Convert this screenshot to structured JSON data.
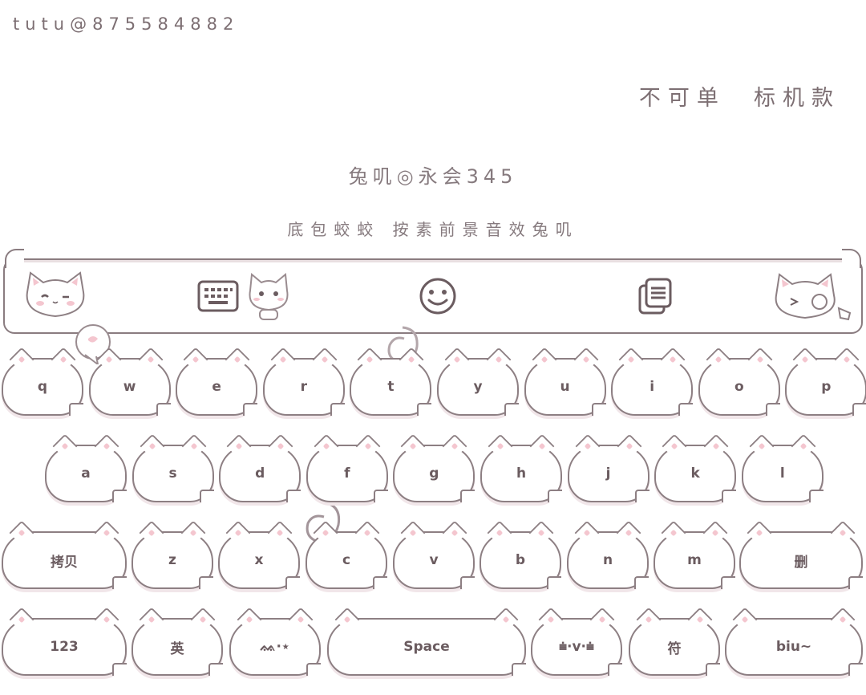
{
  "header": {
    "watermark": "tutu@875584882",
    "style_name": "不可单  标机款",
    "headline": "兔叽◎永会345",
    "subline": "底包蛟蛟  按素前景音效兔叽"
  },
  "toolbar": {
    "items": [
      {
        "name": "keyboard-icon"
      },
      {
        "name": "emoji-icon"
      },
      {
        "name": "clipboard-icon"
      }
    ]
  },
  "keyboard": {
    "row1": [
      "q",
      "w",
      "e",
      "r",
      "t",
      "y",
      "u",
      "i",
      "o",
      "p"
    ],
    "row2": [
      "a",
      "s",
      "d",
      "f",
      "g",
      "h",
      "j",
      "k",
      "l"
    ],
    "row3": [
      "拷贝",
      "z",
      "x",
      "c",
      "v",
      "b",
      "n",
      "m",
      "删"
    ],
    "row4": [
      "123",
      "英",
      "ᨐ·⋆",
      "Space",
      "⩧·v·⩧",
      "符",
      "biu~"
    ]
  },
  "colors": {
    "outline": "#8d7f83",
    "text": "#6b5c60",
    "ear_pink": "#f4c6cf",
    "shadow": "#f1e6e9"
  }
}
